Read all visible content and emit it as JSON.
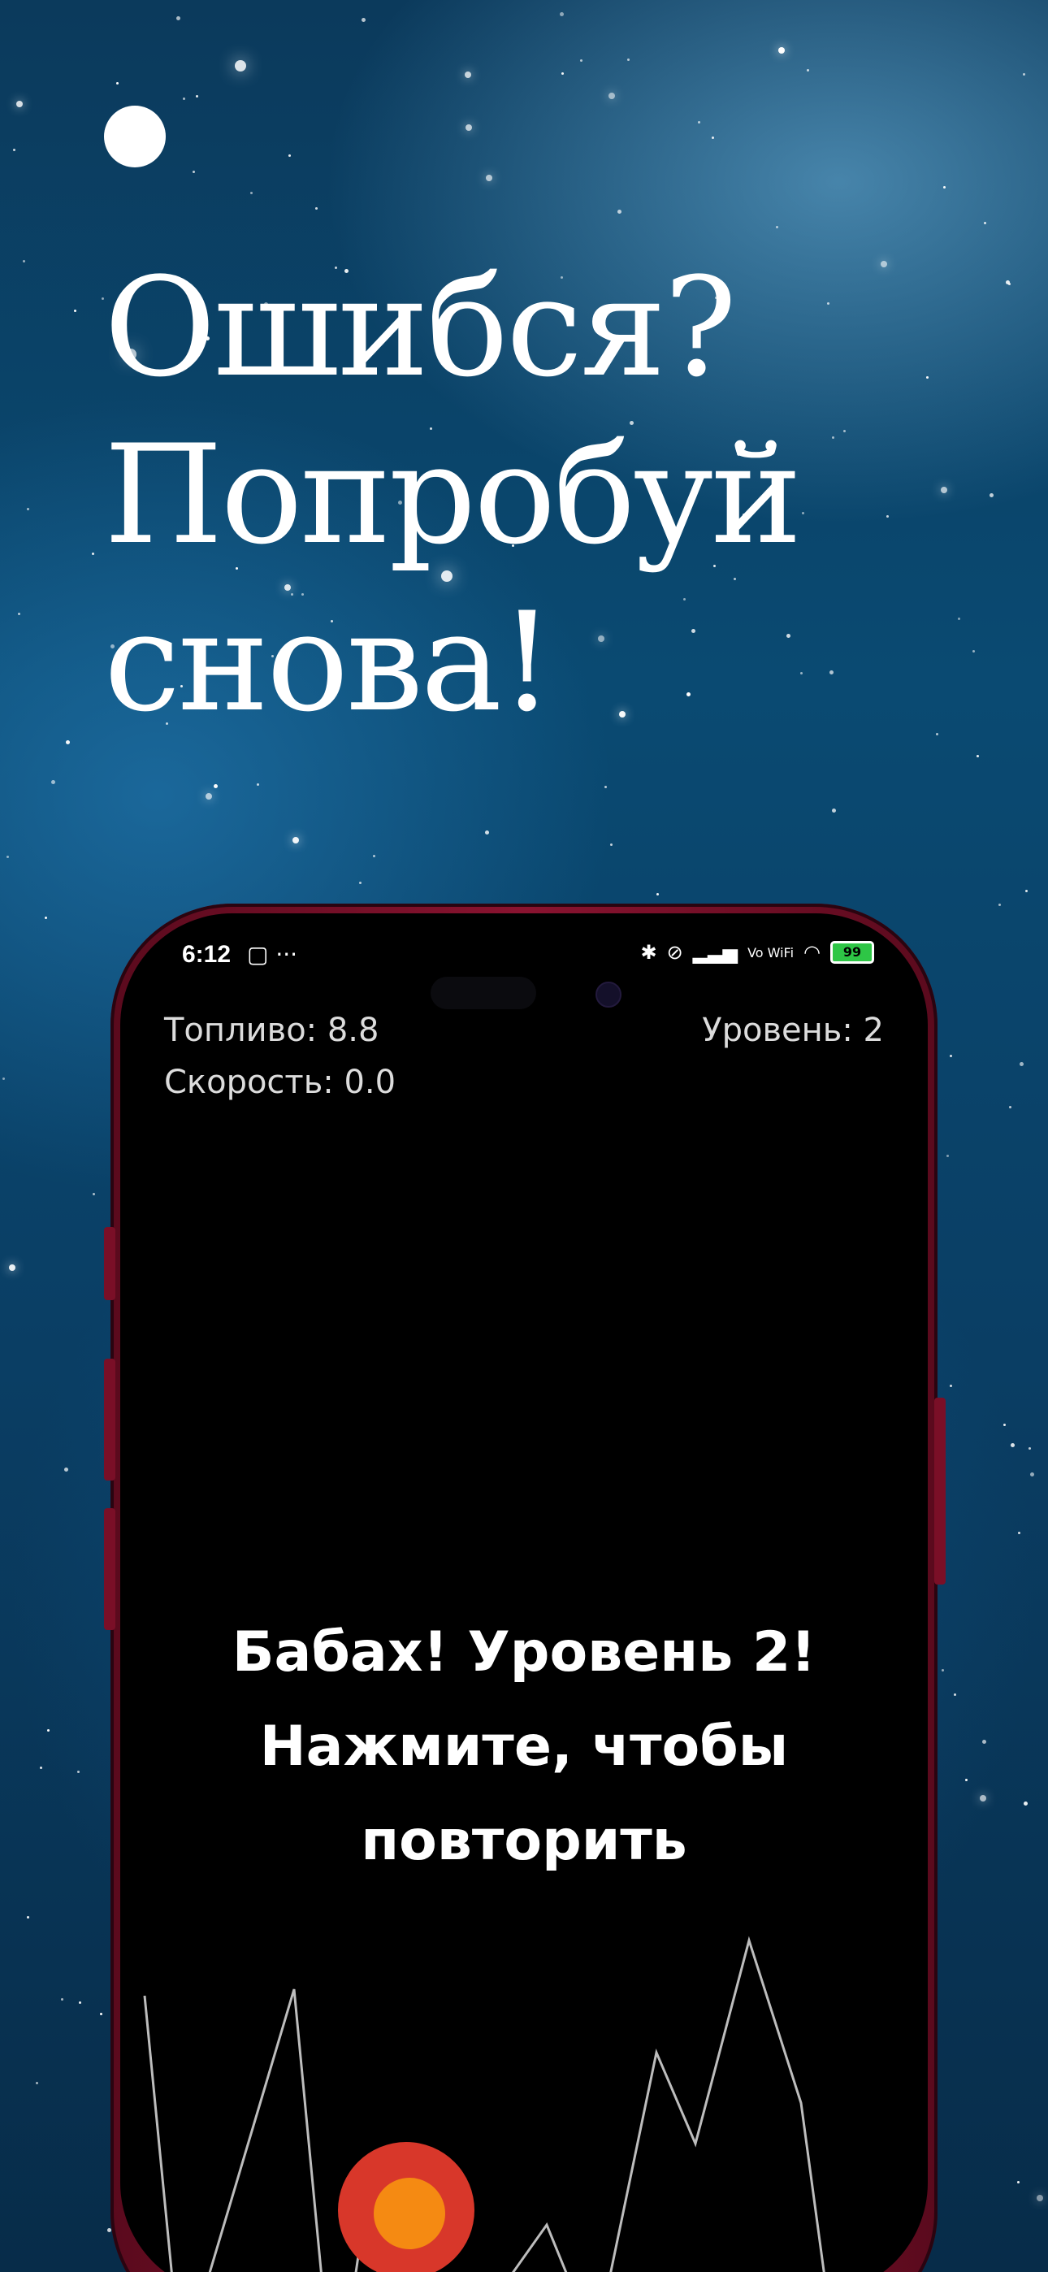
{
  "headline": {
    "line1": "Ошибся?",
    "line2": "Попробуй",
    "line3": "снова!"
  },
  "status_bar": {
    "time": "6:12",
    "left_icons": "▢ ···",
    "network_label": "Vo WiFi",
    "battery": "99"
  },
  "hud": {
    "fuel": "Топливо: 8.8",
    "speed": "Скорость: 0.0",
    "level": "Уровень: 2"
  },
  "message": {
    "line1": "Бабах! Уровень 2!",
    "line2": "Нажмите, чтобы",
    "line3": "повторить"
  },
  "colors": {
    "screen_bg": "#000000",
    "phone_frame": "#8a1330",
    "ship_outer": "#d8372a",
    "ship_inner": "#f58a12",
    "landing_pad": "#4cd64c",
    "terrain_line": "#bdbdbd"
  }
}
